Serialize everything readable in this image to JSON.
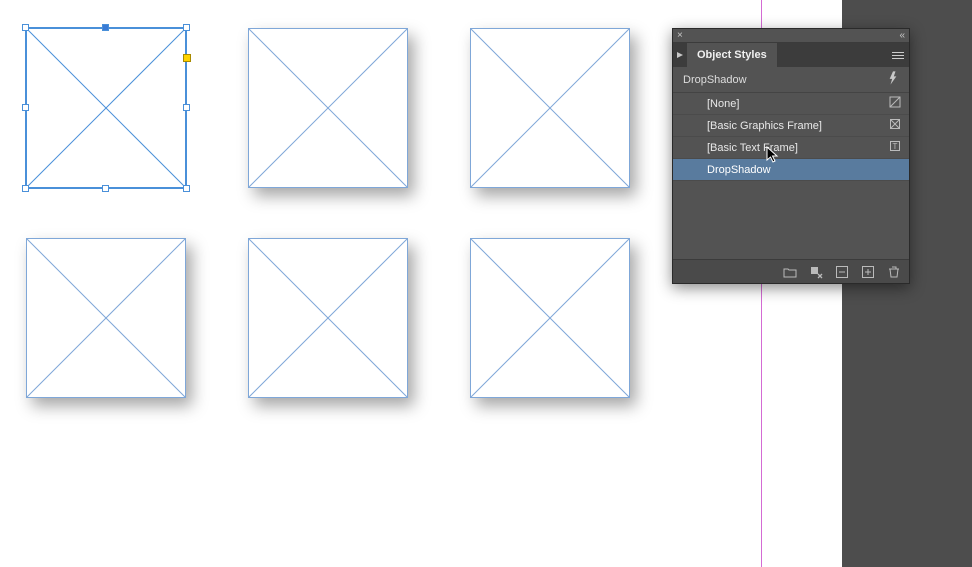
{
  "panel": {
    "title": "Object Styles",
    "applied_style": "DropShadow",
    "rows": {
      "none": "[None]",
      "basic_graphics": "[Basic Graphics Frame]",
      "basic_text": "[Basic Text Frame]",
      "dropshadow": "DropShadow"
    }
  }
}
